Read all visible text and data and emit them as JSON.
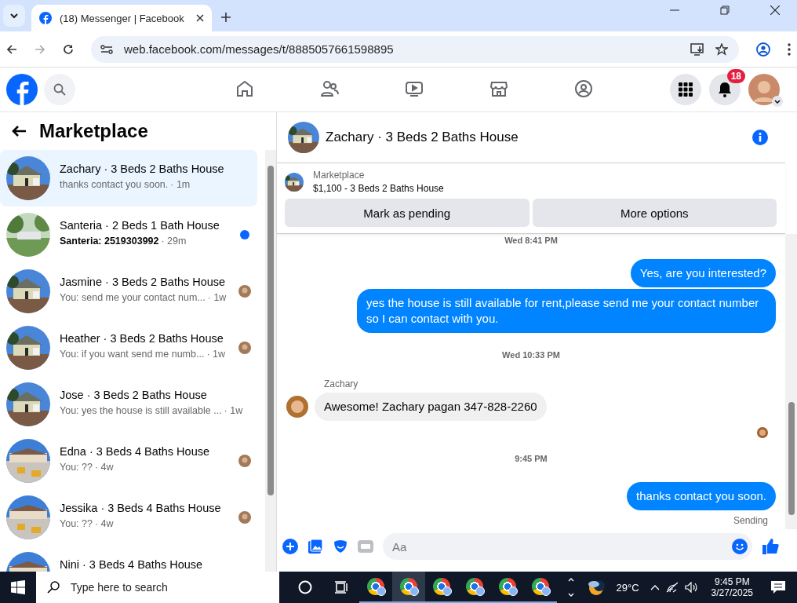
{
  "browser": {
    "tab": {
      "title": "(18) Messenger | Facebook",
      "selected": true
    },
    "url": "web.facebook.com/messages/t/8885057661598895"
  },
  "nav": {
    "items": [
      {
        "kind": "home",
        "selected": false
      },
      {
        "kind": "friends",
        "selected": false
      },
      {
        "kind": "video",
        "selected": false
      },
      {
        "kind": "store",
        "selected": false
      },
      {
        "kind": "groups",
        "selected": false
      }
    ],
    "notification_count": "18"
  },
  "sidebar": {
    "title": "Marketplace",
    "conversations": [
      {
        "title": "Zachary · 3 Beds 2 Baths House",
        "preview": "thanks contact you soon.",
        "time": "· 1m",
        "selected": true,
        "unread": false,
        "seen": false
      },
      {
        "title": "Santeria · 2 Beds 1 Bath House",
        "preview": "Santeria: 2519303992",
        "time": "· 29m",
        "selected": false,
        "unread": true,
        "seen": false
      },
      {
        "title": "Jasmine · 3 Beds 2 Baths House",
        "preview": "You: send me your contact num...",
        "time": "· 1w",
        "selected": false,
        "unread": false,
        "seen": true
      },
      {
        "title": "Heather · 3 Beds 2 Baths House",
        "preview": "You: if you want send me numb...",
        "time": "· 1w",
        "selected": false,
        "unread": false,
        "seen": true
      },
      {
        "title": "Jose · 3 Beds 2 Baths House",
        "preview": "You: yes the house is still available ...",
        "time": "· 1w",
        "selected": false,
        "unread": false,
        "seen": false
      },
      {
        "title": "Edna · 3 Beds 4 Baths House",
        "preview": "You: ??",
        "time": "· 4w",
        "selected": false,
        "unread": false,
        "seen": true
      },
      {
        "title": "Jessika · 3 Beds 4 Baths House",
        "preview": "You: ??",
        "time": "· 4w",
        "selected": false,
        "unread": false,
        "seen": true
      },
      {
        "title": "Nini · 3 Beds 4 Baths House",
        "selected": false,
        "unread": false,
        "seen": false
      }
    ]
  },
  "chat": {
    "title": "Zachary · 3 Beds 2 Baths House",
    "listing": {
      "label": "Marketplace",
      "price": "$1,100 - 3 Beds 2 Baths House"
    },
    "buttons": [
      "Mark as pending",
      "More options"
    ],
    "messages": [
      {
        "kind": "time",
        "text": "Wed 8:41 PM"
      },
      {
        "kind": "out",
        "text": "Yes, are you interested?"
      },
      {
        "kind": "out",
        "text": "yes the house is still available for rent,please send me your contact number so I can contact with you."
      },
      {
        "kind": "time",
        "text": "Wed 10:33 PM"
      },
      {
        "kind": "in",
        "sender": "Zachary",
        "text": "Awesome! Zachary pagan 347-828-2260"
      },
      {
        "kind": "seen"
      },
      {
        "kind": "time",
        "text": "9:45 PM"
      },
      {
        "kind": "out",
        "text": "thanks contact you soon."
      },
      {
        "kind": "status",
        "text": "Sending"
      }
    ],
    "composer": {
      "placeholder": "Aa"
    }
  },
  "taskbar": {
    "search_placeholder": "Type here to search",
    "apps": [
      {
        "selected": false
      },
      {
        "selected": true
      },
      {
        "selected": false
      },
      {
        "selected": false
      },
      {
        "selected": false
      },
      {
        "selected": false
      }
    ],
    "temperature": "29°C",
    "time": "9:45 PM",
    "date": "3/27/2025"
  }
}
